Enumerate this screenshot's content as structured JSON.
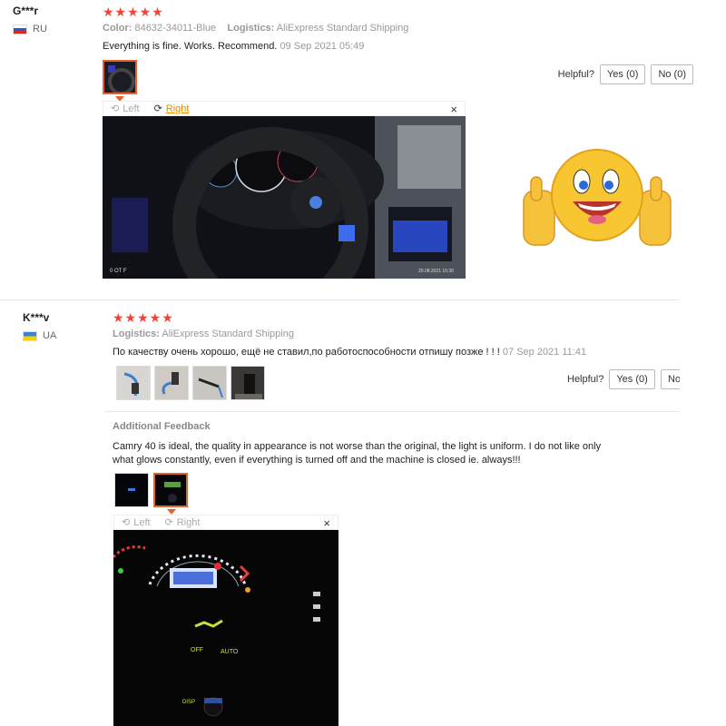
{
  "review1": {
    "user": "G***r",
    "country": "RU",
    "stars": "★★★★★",
    "color_label": "Color:",
    "color_value": "84632-34011-Blue",
    "logistics_label": "Logistics:",
    "logistics_value": "AliExpress Standard Shipping",
    "text": "Everything is fine. Works. Recommend.",
    "date": "09 Sep 2021 05:49",
    "helpful_label": "Helpful?",
    "yes_label": "Yes (0)",
    "no_label": "No (0)",
    "viewer": {
      "left_label": "Left",
      "right_label": "Right",
      "close": "×",
      "photo_caption": "20.08.2021 15:30",
      "photo_corner": "0 OT F"
    }
  },
  "review2": {
    "user": "K***v",
    "country": "UA",
    "stars": "★★★★★",
    "logistics_label": "Logistics:",
    "logistics_value": "AliExpress Standard Shipping",
    "text": "По качеству очень хорошо, ещё не ставил,по работоспособности отпишу позже ! ! !",
    "date": "07 Sep 2021 11:41",
    "helpful_label": "Helpful?",
    "yes_label": "Yes (0)",
    "no_label": "No",
    "additional_title": "Additional Feedback",
    "additional_text": "Camry 40 is ideal, the quality in appearance is not worse than the original, the light is uniform. I do not like only what glows constantly, even if everything is turned off and the machine is closed ie. always!!!",
    "viewer": {
      "left_label": "Left",
      "right_label": "Right",
      "close": "×",
      "off_label": "OFF",
      "auto_label": "AUTO",
      "disp_label": "DISP"
    }
  },
  "colors": {
    "star": "#f44336",
    "accent": "#e8632c",
    "link": "#e88a00"
  }
}
